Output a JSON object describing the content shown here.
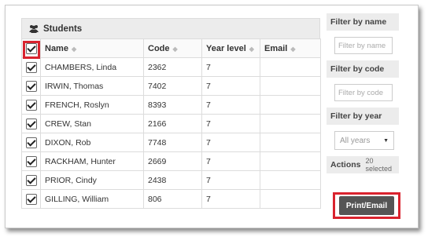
{
  "panel": {
    "title": "Students",
    "icon": "users-icon"
  },
  "columns": [
    "Name",
    "Code",
    "Year level",
    "Email"
  ],
  "rows": [
    {
      "name": "CHAMBERS, Linda",
      "code": "2362",
      "year": "7",
      "email": ""
    },
    {
      "name": "IRWIN, Thomas",
      "code": "7402",
      "year": "7",
      "email": ""
    },
    {
      "name": "FRENCH, Roslyn",
      "code": "8393",
      "year": "7",
      "email": ""
    },
    {
      "name": "CREW, Stan",
      "code": "2166",
      "year": "7",
      "email": ""
    },
    {
      "name": "DIXON, Rob",
      "code": "7748",
      "year": "7",
      "email": ""
    },
    {
      "name": "RACKHAM, Hunter",
      "code": "2669",
      "year": "7",
      "email": ""
    },
    {
      "name": "PRIOR, Cindy",
      "code": "2438",
      "year": "7",
      "email": ""
    },
    {
      "name": "GILLING, William",
      "code": "806",
      "year": "7",
      "email": ""
    }
  ],
  "sidebar": {
    "filter_name_title": "Filter by name",
    "filter_name_placeholder": "Filter by name",
    "filter_code_title": "Filter by code",
    "filter_code_placeholder": "Filter by code",
    "filter_year_title": "Filter by year",
    "filter_year_value": "All years",
    "actions_title": "Actions",
    "selected_count": "20 selected",
    "print_button": "Print/Email"
  },
  "colors": {
    "highlight": "#d9232e",
    "button": "#555555"
  }
}
